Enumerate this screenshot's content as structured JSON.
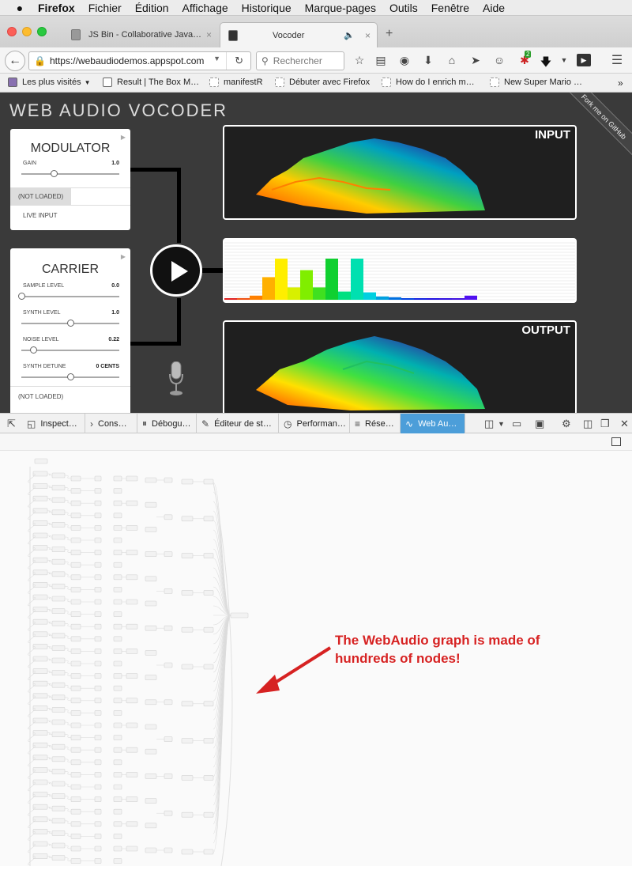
{
  "menubar": {
    "apple": "",
    "items": [
      "Firefox",
      "Fichier",
      "Édition",
      "Affichage",
      "Historique",
      "Marque-pages",
      "Outils",
      "Fenêtre",
      "Aide"
    ]
  },
  "tabs": [
    {
      "label": "JS Bin - Collaborative Java…",
      "close": "×"
    },
    {
      "label": "Vocoder",
      "close": "×",
      "active": true
    }
  ],
  "new_tab": "+",
  "navbar": {
    "url": "https://webaudiodemos.appspot.com",
    "search_placeholder": "Rechercher",
    "notification_badge": "2"
  },
  "bookmarks": [
    {
      "label": "Les plus visités"
    },
    {
      "label": "Result | The Box M…"
    },
    {
      "label": "manifestR"
    },
    {
      "label": "Débuter avec Firefox"
    },
    {
      "label": "How do I enrich m…"
    },
    {
      "label": "New Super Mario …"
    }
  ],
  "app": {
    "title": "WEB AUDIO VOCODER",
    "ribbon": "Fork me on GitHub",
    "modulator": {
      "title": "MODULATOR",
      "gain_label": "GAIN",
      "gain_value": "1.0",
      "gain_fraction": 0.33,
      "not_loaded": "(NOT LOADED)",
      "live_input": "LIVE INPUT"
    },
    "carrier": {
      "title": "CARRIER",
      "sliders": [
        {
          "label": "SAMPLE LEVEL",
          "value": "0.0",
          "fraction": 0.0
        },
        {
          "label": "SYNTH LEVEL",
          "value": "1.0",
          "fraction": 0.5
        },
        {
          "label": "NOISE LEVEL",
          "value": "0.22",
          "fraction": 0.12
        },
        {
          "label": "SYNTH DETUNE",
          "value": "0 CENTS",
          "fraction": 0.5
        }
      ],
      "not_loaded": "(NOT LOADED)"
    },
    "input_label": "INPUT",
    "output_label": "OUTPUT",
    "bands": [
      {
        "v": 0.02,
        "c": "#e02020"
      },
      {
        "v": 0.04,
        "c": "#f05010"
      },
      {
        "v": 0.1,
        "c": "#ff8000"
      },
      {
        "v": 0.55,
        "c": "#ffb000"
      },
      {
        "v": 1.0,
        "c": "#ffee00"
      },
      {
        "v": 0.3,
        "c": "#d8f000"
      },
      {
        "v": 0.72,
        "c": "#80ee00"
      },
      {
        "v": 0.3,
        "c": "#40e020"
      },
      {
        "v": 1.0,
        "c": "#10d030"
      },
      {
        "v": 0.2,
        "c": "#00e080"
      },
      {
        "v": 1.0,
        "c": "#00e0b0"
      },
      {
        "v": 0.18,
        "c": "#00d0e0"
      },
      {
        "v": 0.08,
        "c": "#00a0e0"
      },
      {
        "v": 0.06,
        "c": "#0070e0"
      },
      {
        "v": 0.02,
        "c": "#0040e0"
      },
      {
        "v": 0.02,
        "c": "#1020e0"
      },
      {
        "v": 0.02,
        "c": "#2010e0"
      },
      {
        "v": 0.02,
        "c": "#3010e0"
      },
      {
        "v": 0.02,
        "c": "#4010e0"
      },
      {
        "v": 0.1,
        "c": "#5010f0"
      }
    ]
  },
  "devtools": {
    "tabs": [
      {
        "icon": "◱",
        "label": "Inspect…"
      },
      {
        "icon": "›",
        "label": "Cons…"
      },
      {
        "icon": "⏸",
        "label": "Débogu…"
      },
      {
        "icon": "✎",
        "label": "Éditeur de st…"
      },
      {
        "icon": "◷",
        "label": "Performan…"
      },
      {
        "icon": "≡",
        "label": "Rése…"
      },
      {
        "icon": "∿",
        "label": "Web Au…",
        "active": true
      }
    ]
  },
  "annotation": {
    "line1": "The WebAudio graph is made of",
    "line2": "hundreds of nodes!"
  }
}
